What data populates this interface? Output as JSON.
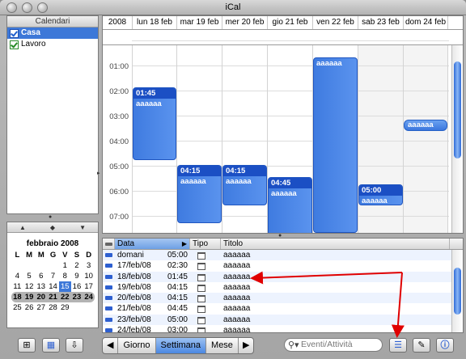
{
  "window": {
    "title": "iCal"
  },
  "sidebar": {
    "header": "Calendari",
    "calendars": [
      {
        "label": "Casa",
        "color": "#2060d0",
        "selected": true
      },
      {
        "label": "Lavoro",
        "color": "#238a23",
        "selected": false
      }
    ]
  },
  "mini_calendar": {
    "title": "febbraio 2008",
    "weekdays": [
      "L",
      "M",
      "M",
      "G",
      "V",
      "S",
      "D"
    ],
    "weeks": [
      [
        "",
        "",
        "",
        "",
        "1",
        "2",
        "3"
      ],
      [
        "4",
        "5",
        "6",
        "7",
        "8",
        "9",
        "10"
      ],
      [
        "11",
        "12",
        "13",
        "14",
        "15",
        "16",
        "17"
      ],
      [
        "18",
        "19",
        "20",
        "21",
        "22",
        "23",
        "24"
      ],
      [
        "25",
        "26",
        "27",
        "28",
        "29",
        "",
        ""
      ]
    ],
    "today": "15"
  },
  "week_view": {
    "year": "2008",
    "days": [
      "lun 18 feb",
      "mar 19 feb",
      "mer 20 feb",
      "gio 21 feb",
      "ven 22 feb",
      "sab 23 feb",
      "dom 24 feb"
    ],
    "hours": [
      "01:00",
      "02:00",
      "03:00",
      "04:00",
      "05:00",
      "06:00",
      "07:00"
    ],
    "events": [
      {
        "day": 0,
        "time": "01:45",
        "title": "aaaaaa"
      },
      {
        "day": 1,
        "time": "04:15",
        "title": "aaaaaa"
      },
      {
        "day": 2,
        "time": "04:15",
        "title": "aaaaaa"
      },
      {
        "day": 3,
        "time": "04:45",
        "title": "aaaaaa"
      },
      {
        "day": 4,
        "time": "",
        "title": "aaaaaa"
      },
      {
        "day": 5,
        "time": "05:00",
        "title": "aaaaaa"
      },
      {
        "day": 6,
        "time": "",
        "title": "aaaaaa"
      }
    ]
  },
  "list": {
    "headers": {
      "date": "Data",
      "type": "Tipo",
      "title": "Titolo"
    },
    "rows": [
      {
        "date": "domani",
        "time": "05:00",
        "title": "aaaaaa"
      },
      {
        "date": "17/feb/08",
        "time": "02:30",
        "title": "aaaaaa"
      },
      {
        "date": "18/feb/08",
        "time": "01:45",
        "title": "aaaaaa"
      },
      {
        "date": "19/feb/08",
        "time": "04:15",
        "title": "aaaaaa"
      },
      {
        "date": "20/feb/08",
        "time": "04:15",
        "title": "aaaaaa"
      },
      {
        "date": "21/feb/08",
        "time": "04:45",
        "title": "aaaaaa"
      },
      {
        "date": "23/feb/08",
        "time": "05:00",
        "title": "aaaaaa"
      },
      {
        "date": "24/feb/08",
        "time": "03:00",
        "title": "aaaaaa"
      }
    ]
  },
  "toolbar": {
    "view_tabs": [
      "Giorno",
      "Settimana",
      "Mese"
    ],
    "active_tab": "Settimana",
    "search_placeholder": "Eventi/Attività"
  },
  "colors": {
    "accent": "#3d78d8",
    "event": "#3f7be0",
    "arrow": "#e00000"
  }
}
